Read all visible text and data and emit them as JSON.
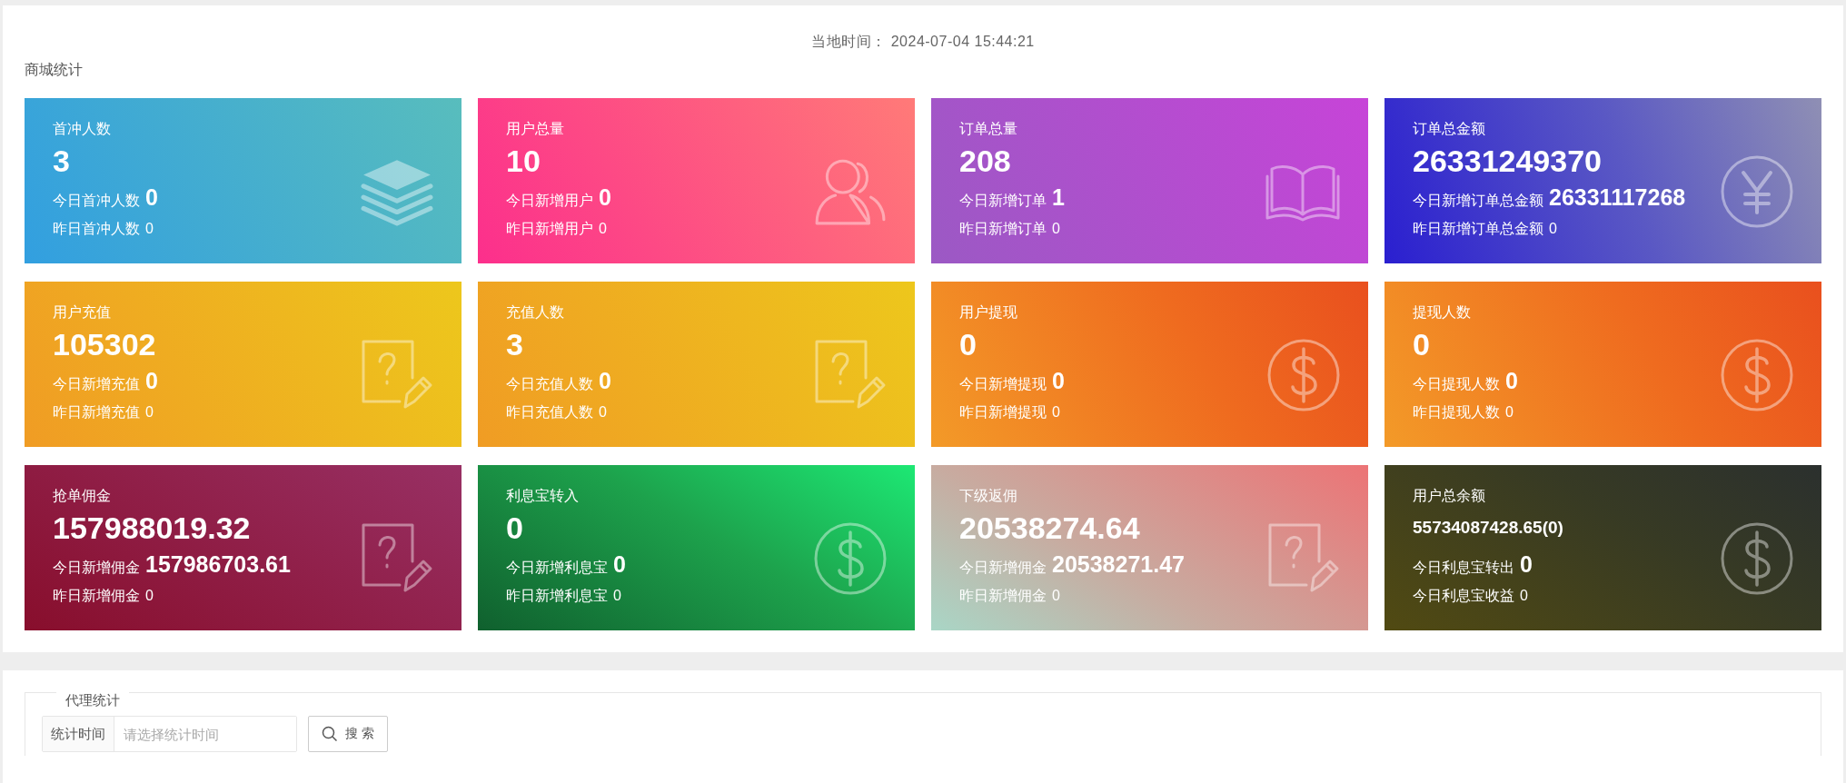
{
  "local_time": {
    "label": "当地时间：",
    "value": "2024-07-04 15:44:21"
  },
  "mall_stats": {
    "title": "商城统计",
    "cards": [
      {
        "title": "首冲人数",
        "value": "3",
        "today_label": "今日首冲人数",
        "today_value": "0",
        "yesterday_label": "昨日首冲人数",
        "yesterday_value": "0",
        "kind": "layers"
      },
      {
        "title": "用户总量",
        "value": "10",
        "today_label": "今日新增用户",
        "today_value": "0",
        "yesterday_label": "昨日新增用户",
        "yesterday_value": "0",
        "kind": "users"
      },
      {
        "title": "订单总量",
        "value": "208",
        "today_label": "今日新增订单",
        "today_value": "1",
        "yesterday_label": "昨日新增订单",
        "yesterday_value": "0",
        "kind": "book"
      },
      {
        "title": "订单总金额",
        "value": "26331249370",
        "today_label": "今日新增订单总金额",
        "today_value": "26331117268",
        "yesterday_label": "昨日新增订单总金额",
        "yesterday_value": "0",
        "kind": "yen"
      },
      {
        "title": "用户充值",
        "value": "105302",
        "today_label": "今日新增充值",
        "today_value": "0",
        "yesterday_label": "昨日新增充值",
        "yesterday_value": "0",
        "kind": "note"
      },
      {
        "title": "充值人数",
        "value": "3",
        "today_label": "今日充值人数",
        "today_value": "0",
        "yesterday_label": "昨日充值人数",
        "yesterday_value": "0",
        "kind": "note"
      },
      {
        "title": "用户提现",
        "value": "0",
        "today_label": "今日新增提现",
        "today_value": "0",
        "yesterday_label": "昨日新增提现",
        "yesterday_value": "0",
        "kind": "dollar"
      },
      {
        "title": "提现人数",
        "value": "0",
        "today_label": "今日提现人数",
        "today_value": "0",
        "yesterday_label": "昨日提现人数",
        "yesterday_value": "0",
        "kind": "dollar"
      },
      {
        "title": "抢单佣金",
        "value": "157988019.32",
        "today_label": "今日新增佣金",
        "today_value": "157986703.61",
        "yesterday_label": "昨日新增佣金",
        "yesterday_value": "0",
        "kind": "note"
      },
      {
        "title": "利息宝转入",
        "value": "0",
        "today_label": "今日新增利息宝",
        "today_value": "0",
        "yesterday_label": "昨日新增利息宝",
        "yesterday_value": "0",
        "kind": "dollar"
      },
      {
        "title": "下级返佣",
        "value": "20538274.64",
        "today_label": "今日新增佣金",
        "today_value": "20538271.47",
        "yesterday_label": "昨日新增佣金",
        "yesterday_value": "0",
        "kind": "note"
      },
      {
        "title": "用户总余额",
        "value": "55734087428.65(0)",
        "today_label": "今日利息宝转出",
        "today_value": "0",
        "yesterday_label": "今日利息宝收益",
        "yesterday_value": "0",
        "kind": "dollar"
      }
    ]
  },
  "agent_stats": {
    "title": "代理统计",
    "filter_label": "统计时间",
    "date_field": {
      "placeholder": "请选择统计时间"
    },
    "search_button": "搜 索"
  }
}
